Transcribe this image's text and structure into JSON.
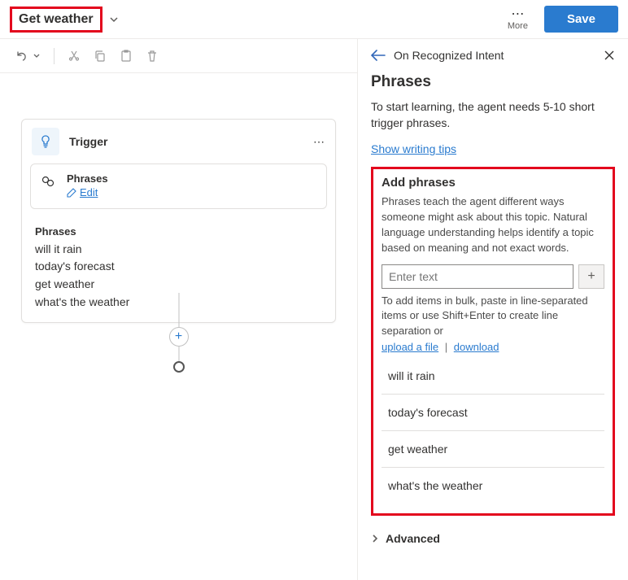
{
  "header": {
    "title": "Get weather",
    "more_label": "More",
    "save_label": "Save"
  },
  "trigger": {
    "label": "Trigger",
    "phrases_card_title": "Phrases",
    "edit_label": "Edit",
    "phrases_block_title": "Phrases",
    "phrases": [
      "will it rain",
      "today's forecast",
      "get weather",
      "what's the weather"
    ]
  },
  "panel": {
    "back_target": "On Recognized Intent",
    "title": "Phrases",
    "description": "To start learning, the agent needs 5-10 short trigger phrases.",
    "tips_link": "Show writing tips",
    "add_section_title": "Add phrases",
    "add_help": "Phrases teach the agent different ways someone might ask about this topic. Natural language understanding helps identify a topic based on meaning and not exact words.",
    "input_placeholder": "Enter text",
    "bulk_text": "To add items in bulk, paste in line-separated items or use Shift+Enter to create line separation or",
    "upload_link": "upload a file",
    "download_link": "download",
    "phrases": [
      "will it rain",
      "today's forecast",
      "get weather",
      "what's the weather"
    ],
    "advanced_label": "Advanced"
  }
}
